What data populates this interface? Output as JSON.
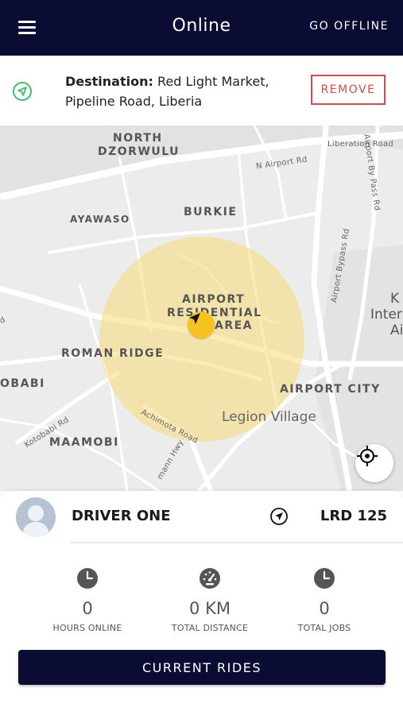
{
  "header": {
    "title": "Online",
    "go_offline_label": "GO OFFLINE"
  },
  "destination": {
    "label": "Destination:",
    "value": "Red Light Market, Pipeline Road, Liberia",
    "remove_label": "REMOVE"
  },
  "map": {
    "labels": {
      "north_dzorwulu_1": "NORTH",
      "north_dzorwulu_2": "DZORWULU",
      "ayawaso": "AYAWASO",
      "burkie": "BURKIE",
      "airport_res_1": "AIRPORT",
      "airport_res_2": "RESIDENTIAL",
      "airport_res_3": "AREA",
      "roman_ridge": "ROMAN RIDGE",
      "obabi": "OBABI",
      "airport_city": "AIRPORT CITY",
      "legion_village": "Legion Village",
      "maamobi": "MAAMOBI",
      "n_airport_rd": "N Airport Rd",
      "liberation_road": "Liberation Road",
      "airport_bypass_rd_1": "Airport By Pass Rd",
      "airport_bypass_rd_2": "Airport Bypass Rd",
      "kotobabi_rd": "Kotobabi Rd",
      "achimota_road": "Achimota Road",
      "amann_hwy": "mann Hwy",
      "edge_k": "K",
      "edge_inter": "Inter",
      "edge_ai": "Ai",
      "edge_d": "d"
    },
    "colors": {
      "range_fill": "#f7dd78",
      "marker": "#f7c11e"
    }
  },
  "driver": {
    "name": "DRIVER ONE",
    "fare": "LRD 125"
  },
  "stats": [
    {
      "icon": "clock-icon",
      "value": "0",
      "label": "HOURS ONLINE"
    },
    {
      "icon": "speedometer-icon",
      "value": "0 KM",
      "label": "TOTAL DISTANCE"
    },
    {
      "icon": "clock-icon",
      "value": "0",
      "label": "TOTAL JOBS"
    }
  ],
  "current_rides_label": "CURRENT RIDES",
  "colors": {
    "header_bg": "#0b0c33",
    "remove_red": "#d94a4a",
    "nav_green": "#3bbf6f"
  }
}
